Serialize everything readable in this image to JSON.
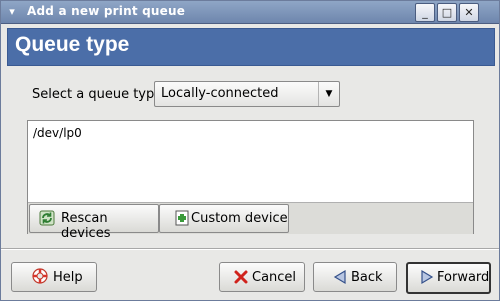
{
  "window": {
    "title": "Add a new print queue",
    "menu_glyph": "▾",
    "min_glyph": "_",
    "max_glyph": "□",
    "close_glyph": "✕"
  },
  "banner": {
    "title": "Queue type"
  },
  "queue_type": {
    "label": "Select a queue type:",
    "selected": "Locally-connected",
    "arrow": "▼"
  },
  "devices": {
    "items": [
      "/dev/lp0"
    ],
    "rescan_label": "Rescan devices",
    "custom_label": "Custom device"
  },
  "buttons": {
    "help": "Help",
    "cancel": "Cancel",
    "back": "Back",
    "forward": "Forward"
  },
  "colors": {
    "titlebar": "#7b91b7",
    "banner": "#4b6ea8",
    "window_bg": "#e8e8e6"
  }
}
